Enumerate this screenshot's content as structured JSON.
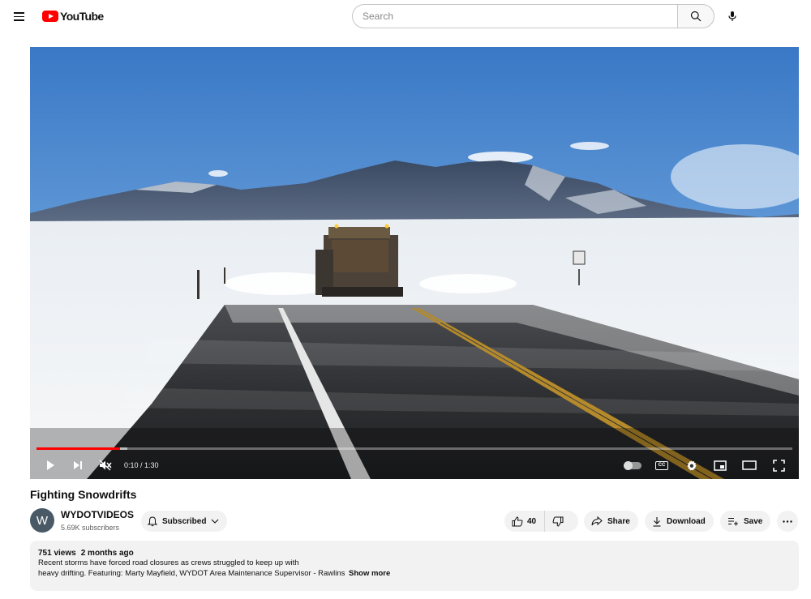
{
  "header": {
    "logo_text": "YouTube",
    "search": {
      "placeholder": "Search",
      "value": ""
    }
  },
  "player": {
    "time_current": "0:10",
    "time_total": "1:30",
    "time_display": "0:10 / 1:30",
    "progress_fraction": 0.111,
    "buffered_fraction": 0.12,
    "muted": true,
    "captions_label": "CC",
    "icons": {
      "play": "play-icon",
      "next": "next-icon",
      "volume": "muted-volume-icon",
      "autoplay": "autoplay-toggle-icon",
      "captions": "captions-icon",
      "settings": "gear-icon",
      "miniplayer": "miniplayer-icon",
      "theater": "theater-mode-icon",
      "fullscreen": "fullscreen-icon"
    }
  },
  "video": {
    "title": "Fighting Snowdrifts"
  },
  "channel": {
    "avatar_letter": "W",
    "name": "WYDOTVIDEOS",
    "subscribers": "5.69K subscribers",
    "subscribe_label": "Subscribed"
  },
  "actions": {
    "like_count": "40",
    "share_label": "Share",
    "download_label": "Download",
    "save_label": "Save"
  },
  "description": {
    "views": "751 views",
    "age": "2 months ago",
    "line1": "Recent storms have forced road closures as crews struggled to keep up with",
    "line2": "heavy drifting. Featuring: Marty Mayfield, WYDOT Area Maintenance Supervisor - Rawlins",
    "show_more": "Show more"
  },
  "colors": {
    "brand_red": "#ff0000",
    "progress_red": "#ff0000",
    "pill_bg": "#f2f2f2",
    "avatar_bg": "#495a66"
  }
}
